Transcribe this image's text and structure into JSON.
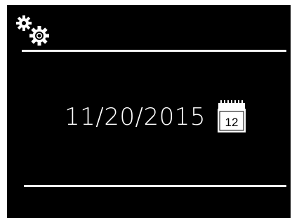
{
  "screen": {
    "settings_icon": "gears-icon",
    "date_value": "11/20/2015",
    "calendar": {
      "icon": "calendar-icon",
      "day": "12"
    }
  },
  "colors": {
    "background": "#000000",
    "foreground": "#ffffff",
    "divider": "#f2f2f2"
  }
}
